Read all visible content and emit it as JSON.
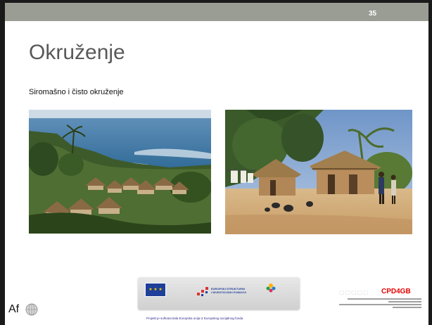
{
  "slide": {
    "number": "35",
    "title": "Okruženje",
    "subtitle": "Siromašno i čisto okruženje",
    "photos": [
      {
        "name": "coastal-village-photo"
      },
      {
        "name": "mud-hut-village-photo"
      }
    ]
  },
  "footer": {
    "eu_stars": "★ ★ ★",
    "esf_text_line1": "EUROPSKI STRUKTURNI",
    "esf_text_line2": "I INVESTICIJSKI FONDOVI",
    "note": "Projekt je sufinancirala Europska unija iz Europskog socijalnog fonda",
    "cpd_brand": "CPD4GB",
    "af_mark": "Af"
  },
  "colors": {
    "top_bar": "#9a9d94",
    "frame": "#1a1a1a",
    "title": "#595959",
    "cpd_red": "#e60000",
    "eu_blue": "#1f3f99"
  }
}
